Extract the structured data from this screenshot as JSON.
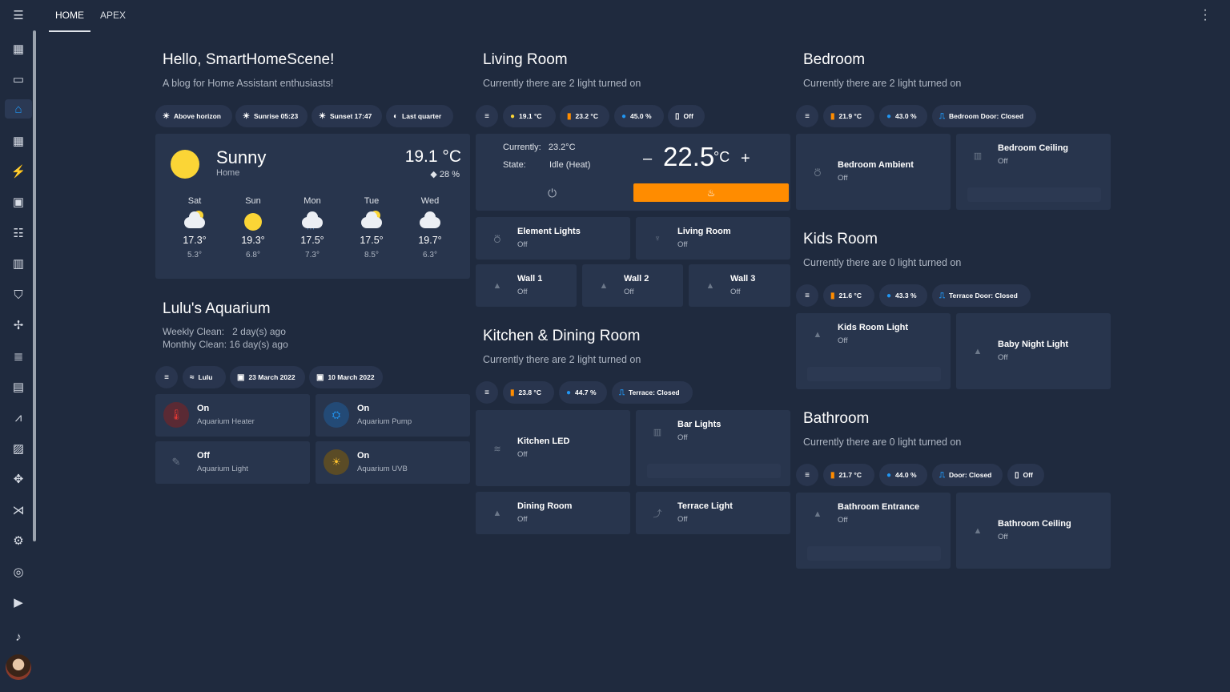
{
  "tabs": [
    "HOME",
    "APEX"
  ],
  "intro": {
    "title": "Hello, SmartHomeScene!",
    "subtitle": "A blog for Home Assistant enthusiasts!",
    "chips": [
      "Above horizon",
      "Sunrise 05:23",
      "Sunset 17:47",
      "Last quarter"
    ]
  },
  "weather": {
    "condition": "Sunny",
    "location": "Home",
    "temp": "19.1",
    "unit": "°C",
    "humidity": "28 %",
    "forecast": [
      {
        "day": "Sat",
        "high": "17.3°",
        "low": "5.3°",
        "icon": "partly-cloudy"
      },
      {
        "day": "Sun",
        "high": "19.3°",
        "low": "6.8°",
        "icon": "sunny"
      },
      {
        "day": "Mon",
        "high": "17.5°",
        "low": "7.3°",
        "icon": "rainy"
      },
      {
        "day": "Tue",
        "high": "17.5°",
        "low": "8.5°",
        "icon": "partly-cloudy"
      },
      {
        "day": "Wed",
        "high": "19.7°",
        "low": "6.3°",
        "icon": "cloudy"
      }
    ]
  },
  "aquarium": {
    "title": "Lulu's Aquarium",
    "weekly_label": "Weekly Clean:",
    "weekly_value": "2 day(s) ago",
    "monthly_label": "Monthly Clean:",
    "monthly_value": "16 day(s) ago",
    "chips": [
      "Lulu",
      "23 March 2022",
      "10 March 2022"
    ],
    "tiles": [
      {
        "state": "On",
        "name": "Aquarium Heater"
      },
      {
        "state": "On",
        "name": "Aquarium Pump"
      },
      {
        "state": "Off",
        "name": "Aquarium Light"
      },
      {
        "state": "On",
        "name": "Aquarium UVB"
      }
    ]
  },
  "living": {
    "title": "Living Room",
    "subtitle": "Currently there are 2 light turned on",
    "chips": [
      "19.1 °C",
      "23.2 °C",
      "45.0 %",
      "Off"
    ],
    "thermostat": {
      "currently_label": "Currently:",
      "currently": "23.2°C",
      "state_label": "State:",
      "state": "Idle (Heat)",
      "target": "22.5",
      "unit": "°C",
      "minus": "–",
      "plus": "+"
    },
    "tiles": [
      {
        "name": "Element Lights",
        "state": "Off"
      },
      {
        "name": "Living Room",
        "state": "Off"
      },
      {
        "name": "Wall 1",
        "state": "Off"
      },
      {
        "name": "Wall 2",
        "state": "Off"
      },
      {
        "name": "Wall 3",
        "state": "Off"
      }
    ]
  },
  "kitchen": {
    "title": "Kitchen & Dining Room",
    "subtitle": "Currently there are 2 light turned on",
    "chips": [
      "23.8 °C",
      "44.7 %",
      "Terrace: Closed"
    ],
    "tiles": [
      {
        "name": "Kitchen LED",
        "state": "Off"
      },
      {
        "name": "Bar Lights",
        "state": "Off"
      },
      {
        "name": "Dining Room",
        "state": "Off"
      },
      {
        "name": "Terrace Light",
        "state": "Off"
      }
    ]
  },
  "bedroom": {
    "title": "Bedroom",
    "subtitle": "Currently there are 2 light turned on",
    "chips": [
      "21.9 °C",
      "43.0 %",
      "Bedroom Door: Closed"
    ],
    "tiles": [
      {
        "name": "Bedroom Ambient",
        "state": "Off"
      },
      {
        "name": "Bedroom Ceiling",
        "state": "Off"
      }
    ]
  },
  "kids": {
    "title": "Kids Room",
    "subtitle": "Currently there are 0 light turned on",
    "chips": [
      "21.6 °C",
      "43.3 %",
      "Terrace Door: Closed"
    ],
    "tiles": [
      {
        "name": "Kids Room Light",
        "state": "Off"
      },
      {
        "name": "Baby Night Light",
        "state": "Off"
      }
    ]
  },
  "bathroom": {
    "title": "Bathroom",
    "subtitle": "Currently there are 0 light turned on",
    "chips": [
      "21.7 °C",
      "44.0 %",
      "Door: Closed",
      "Off"
    ],
    "tiles": [
      {
        "name": "Bathroom Entrance",
        "state": "Off"
      },
      {
        "name": "Bathroom Ceiling",
        "state": "Off"
      }
    ]
  },
  "colors": {
    "accent": "#2196f3",
    "heat": "#ff8c00",
    "background": "#1f2a3e",
    "card": "#28354d"
  }
}
